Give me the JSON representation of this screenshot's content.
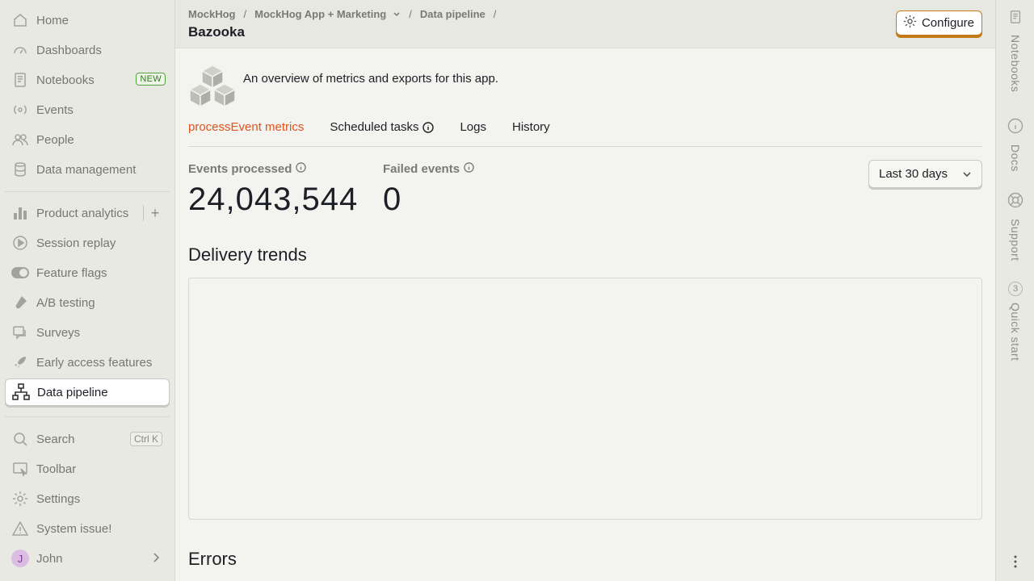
{
  "sidebar": {
    "items": [
      {
        "label": "Home",
        "icon": "home-icon"
      },
      {
        "label": "Dashboards",
        "icon": "dashboard-icon"
      },
      {
        "label": "Notebooks",
        "icon": "notebook-icon",
        "badge": "NEW"
      },
      {
        "label": "Events",
        "icon": "events-icon"
      },
      {
        "label": "People",
        "icon": "people-icon"
      },
      {
        "label": "Data management",
        "icon": "database-icon"
      },
      {
        "label": "Product analytics",
        "icon": "bar-chart-icon"
      },
      {
        "label": "Session replay",
        "icon": "replay-icon"
      },
      {
        "label": "Feature flags",
        "icon": "toggle-icon"
      },
      {
        "label": "A/B testing",
        "icon": "flask-icon"
      },
      {
        "label": "Surveys",
        "icon": "survey-icon"
      },
      {
        "label": "Early access features",
        "icon": "rocket-icon"
      },
      {
        "label": "Data pipeline",
        "icon": "pipeline-icon"
      },
      {
        "label": "Search",
        "icon": "search-icon",
        "shortcut": "Ctrl K"
      },
      {
        "label": "Toolbar",
        "icon": "toolbar-icon"
      },
      {
        "label": "Settings",
        "icon": "gear-icon"
      },
      {
        "label": "System issue!",
        "icon": "warning-icon"
      },
      {
        "label": "John",
        "avatar_initial": "J"
      }
    ]
  },
  "header": {
    "breadcrumbs": [
      "MockHog",
      "MockHog App + Marketing",
      "Data pipeline"
    ],
    "title": "Bazooka",
    "configure_label": "Configure"
  },
  "main": {
    "description": "An overview of metrics and exports for this app.",
    "tabs": [
      "processEvent metrics",
      "Scheduled tasks",
      "Logs",
      "History"
    ],
    "active_tab": "processEvent metrics",
    "metrics": {
      "processed_label": "Events processed",
      "processed_value": "24,043,544",
      "failed_label": "Failed events",
      "failed_value": "0"
    },
    "date_range": "Last 30 days",
    "delivery_title": "Delivery trends",
    "errors_title": "Errors"
  },
  "rail": {
    "items": [
      {
        "label": "Notebooks",
        "icon": "notebook-icon"
      },
      {
        "label": "Docs",
        "icon": "info-icon"
      },
      {
        "label": "Support",
        "icon": "lifebuoy-icon"
      },
      {
        "label": "Quick start",
        "count": "3"
      }
    ]
  },
  "colors": {
    "accent": "#e0551f",
    "configure_border": "#c57a1a",
    "badge_green": "#53a33c"
  }
}
